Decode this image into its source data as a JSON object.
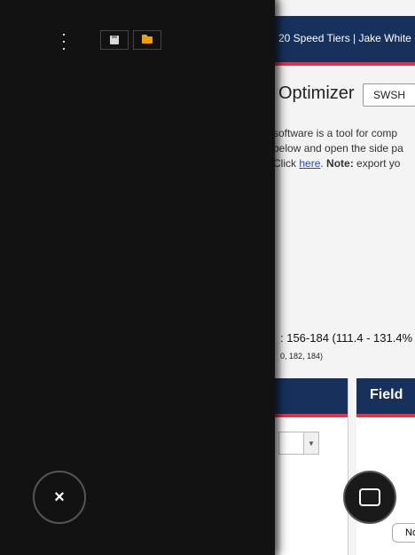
{
  "header": {
    "crumb": "20 Speed Tiers | Jake White"
  },
  "main": {
    "title": "Optimizer",
    "gen_button": "SWSH",
    "desc_lines": {
      "l1": "software is a tool for comp",
      "l2": "below and open the side pa",
      "l3_pre": "Click ",
      "l3_link": "here",
      "l3_mid": ". ",
      "l3_bold": "Note:",
      "l3_post": " export yo"
    },
    "stat": ": 156-184 (111.4 - 131.4%",
    "stat_sub": "0, 182, 184)"
  },
  "panels": {
    "field_title": "Field",
    "no_button": "No"
  },
  "drawer": {
    "close_symbol": "×"
  },
  "icons": {
    "kebab": "kebab-menu-icon",
    "save": "floppy-disk-icon",
    "open": "folder-open-icon",
    "close": "close-icon",
    "frame": "window-frame-icon"
  },
  "colors": {
    "header_bg": "#16325c",
    "accent_red": "#e0344b",
    "drawer_bg": "#121212",
    "link": "#2b49b3"
  }
}
